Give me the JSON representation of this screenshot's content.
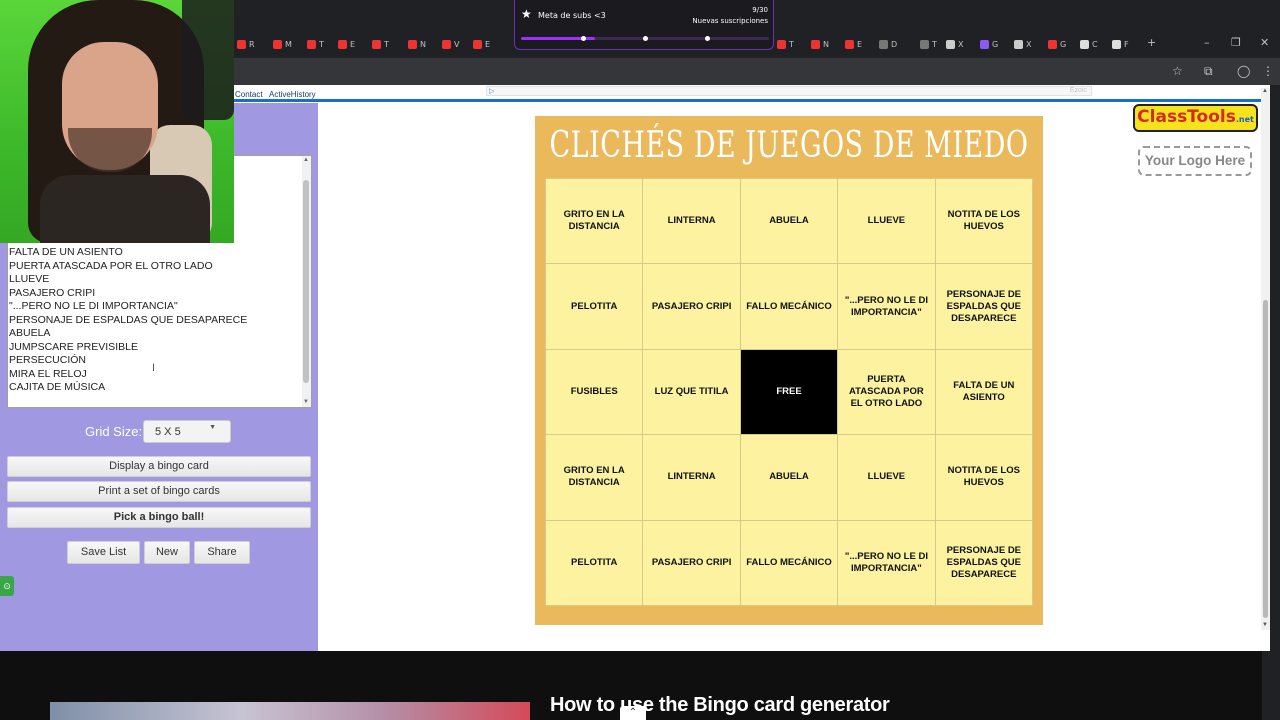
{
  "browser": {
    "tab_labels": [
      "R",
      "M",
      "T",
      "E",
      "T",
      "N",
      "V",
      "E",
      "T",
      "N",
      "E",
      "D",
      "T",
      "X",
      "G",
      "X",
      "G",
      "C",
      "F"
    ],
    "new_tab_glyph": "+",
    "window_controls": [
      "–",
      "❐",
      "✕"
    ]
  },
  "notification": {
    "title": "Meta de subs <3",
    "count": "9/30",
    "subtitle": "Nuevas suscripciones",
    "progress": 0.3
  },
  "navbar": {
    "links": [
      "Contact",
      "ActiveHistory"
    ],
    "ad_label": "Ezoic"
  },
  "left_panel": {
    "list_items": [
      "FALTA DE UN ASIENTO",
      "PUERTA ATASCADA POR EL OTRO LADO",
      "LLUEVE",
      "PASAJERO CRIPI",
      "\"...PERO NO LE DI IMPORTANCIA\"",
      "PERSONAJE DE ESPALDAS QUE DESAPARECE",
      "ABUELA",
      "JUMPSCARE PREVISIBLE",
      "PERSECUCIÓN",
      "MIRA EL RELOJ",
      "CAJITA DE MÚSICA"
    ],
    "grid_size_label": "Grid Size:",
    "grid_size_value": "5 X 5",
    "buttons": {
      "display": "Display a bingo card",
      "print": "Print a set of bingo cards",
      "pick": "Pick a bingo ball!",
      "save": "Save List",
      "new": "New",
      "share": "Share"
    }
  },
  "bingo_card": {
    "title": "CLICHÉS DE JUEGOS DE MIEDO",
    "cells": [
      "GRITO EN LA DISTANCIA",
      "LINTERNA",
      "ABUELA",
      "LLUEVE",
      "NOTITA DE LOS HUEVOS",
      "PELOTITA",
      "PASAJERO CRIPI",
      "FALLO MECÁNICO",
      "\"...PERO NO LE DI IMPORTANCIA\"",
      "PERSONAJE DE ESPALDAS QUE DESAPARECE",
      "FUSIBLES",
      "LUZ QUE TITILA",
      "FREE",
      "PUERTA ATASCADA POR EL OTRO LADO",
      "FALTA DE UN ASIENTO",
      "GRITO EN LA DISTANCIA",
      "LINTERNA",
      "ABUELA",
      "LLUEVE",
      "NOTITA DE LOS HUEVOS",
      "PELOTITA",
      "PASAJERO CRIPI",
      "FALLO MECÁNICO",
      "\"...PERO NO LE DI IMPORTANCIA\"",
      "PERSONAJE DE ESPALDAS QUE DESAPARECE"
    ],
    "free_index": 12
  },
  "logos": {
    "classtools": "ClassTools",
    "classtools_suffix": ".net",
    "your_logo": "Your Logo Here"
  },
  "video": {
    "title": "How to use the Bingo card generator"
  },
  "colors": {
    "panel": "#a098e0",
    "card": "#eab95b",
    "cell": "#fcf2a0",
    "accent_purple": "#9b30ff"
  }
}
